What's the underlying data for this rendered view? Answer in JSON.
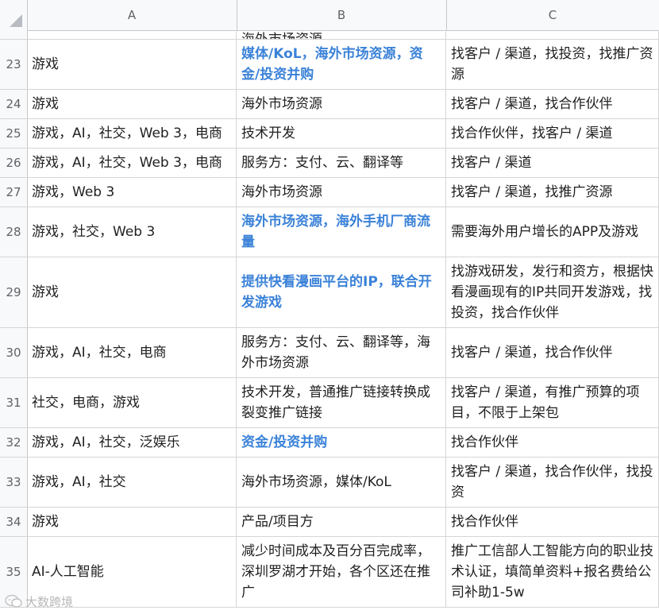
{
  "columns": [
    "A",
    "B",
    "C"
  ],
  "partial_row": {
    "b": "海外市场资源"
  },
  "rows": [
    {
      "num": "23",
      "a": "游戏",
      "b": "媒体/KoL，海外市场资源，资金/投资并购",
      "b_highlight": true,
      "c": "找客户 / 渠道，找投资，找推广资源"
    },
    {
      "num": "24",
      "a": "游戏",
      "b": "海外市场资源",
      "b_highlight": false,
      "c": "找客户 / 渠道，找合作伙伴"
    },
    {
      "num": "25",
      "a": "游戏，AI，社交，Web 3，电商",
      "b": "技术开发",
      "b_highlight": false,
      "c": "找合作伙伴，找客户 / 渠道"
    },
    {
      "num": "26",
      "a": "游戏，AI，社交，Web 3，电商",
      "b": "服务方：支付、云、翻译等",
      "b_highlight": false,
      "c": "找客户 / 渠道"
    },
    {
      "num": "27",
      "a": "游戏，Web 3",
      "b": "海外市场资源",
      "b_highlight": false,
      "c": "找客户 / 渠道，找推广资源"
    },
    {
      "num": "28",
      "a": "游戏，社交，Web 3",
      "b": "海外市场资源，海外手机厂商流量",
      "b_highlight": true,
      "c": "需要海外用户增长的APP及游戏"
    },
    {
      "num": "29",
      "a": "游戏",
      "b": "提供快看漫画平台的IP，联合开发游戏",
      "b_highlight": true,
      "c": "找游戏研发，发行和资方，根据快看漫画现有的IP共同开发游戏，找投资，找合作伙伴"
    },
    {
      "num": "30",
      "a": "游戏，AI，社交，电商",
      "b": "服务方：支付、云、翻译等，海外市场资源",
      "b_highlight": false,
      "c": "找客户 / 渠道，找合作伙伴"
    },
    {
      "num": "31",
      "a": "社交，电商，游戏",
      "b": "技术开发，普通推广链接转换成裂变推广链接",
      "b_highlight": false,
      "c": "找客户 / 渠道，有推广预算的项目，不限于上架包"
    },
    {
      "num": "32",
      "a": "游戏，AI，社交，泛娱乐",
      "b": "资金/投资并购",
      "b_highlight": true,
      "c": "找合作伙伴"
    },
    {
      "num": "33",
      "a": "游戏，AI，社交",
      "b": "海外市场资源，媒体/KoL",
      "b_highlight": false,
      "c": "找客户 / 渠道，找合作伙伴，找投资"
    },
    {
      "num": "34",
      "a": "游戏",
      "b": "产品/项目方",
      "b_highlight": false,
      "c": "找合作伙伴"
    },
    {
      "num": "35",
      "a": "AI-人工智能",
      "b": "减少时间成本及百分百完成率，深圳罗湖才开始，各个区还在推广",
      "b_highlight": false,
      "c": "推广工信部人工智能方向的职业技术认证，填简单资料+报名费给公司补助1-5w"
    }
  ],
  "watermark": "大数跨境",
  "colors": {
    "highlight": "#3b82d8",
    "header_bg": "#f8f9fa",
    "grid": "#d5d5d5"
  }
}
